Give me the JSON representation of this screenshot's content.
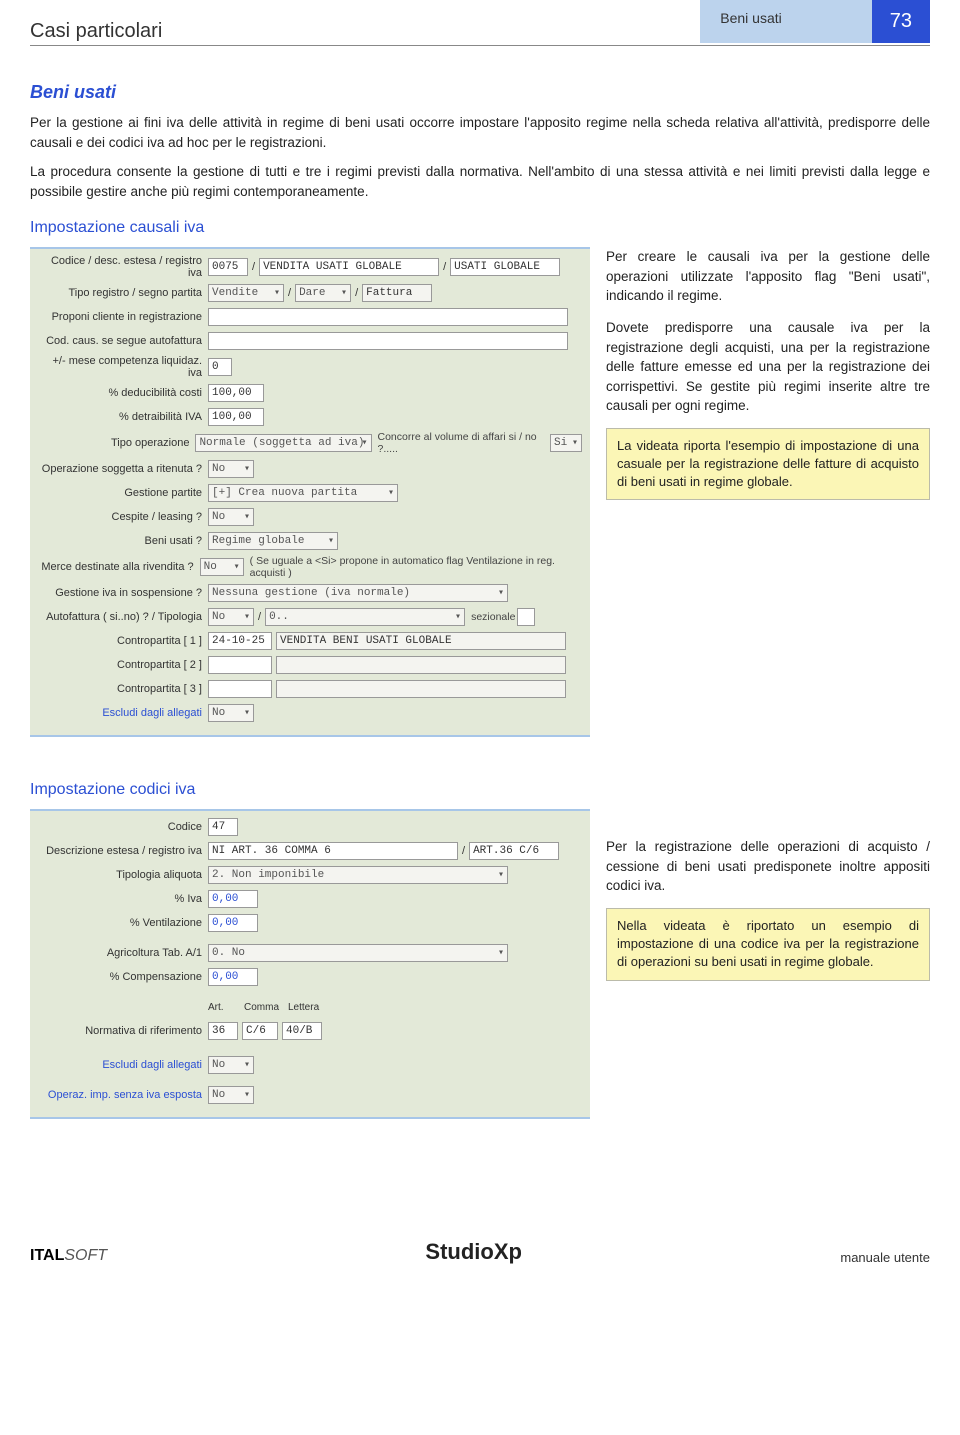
{
  "header": {
    "title": "Casi particolari",
    "tab": "Beni usati",
    "page": "73"
  },
  "section1": {
    "title": "Beni usati",
    "p1": "Per la gestione ai fini iva delle attività in regime di beni usati occorre impostare l'apposito regime nella scheda relativa all'attività, predisporre delle causali e dei codici iva ad hoc per le registrazioni.",
    "p2": "La procedura consente la gestione di tutti e tre i regimi previsti dalla normativa. Nell'ambito di una stessa attività e nei limiti previsti dalla legge e possibile gestire anche più regimi contemporaneamente."
  },
  "section2": {
    "title": "Impostazione causali iva",
    "right_p1": "Per creare le causali iva per la gestione delle operazioni utilizzate l'apposito flag \"Beni usati\", indicando il regime.",
    "right_p2": "Dovete predisporre una causale iva per la registrazione degli acquisti, una per la registrazione delle fatture emesse ed una per la registrazione dei corrispettivi. Se gestite più regimi inserite altre tre causali per ogni regime.",
    "note": "La videata riporta l'esempio di impostazione di una casuale per la registrazione delle fatture di acquisto di beni usati in regime globale."
  },
  "form1": {
    "r1_label": "Codice / desc. estesa / registro iva",
    "r1_code": "0075",
    "r1_desc": "VENDITA USATI GLOBALE",
    "r1_reg": "USATI GLOBALE",
    "r2_label": "Tipo registro / segno partita",
    "r2_tipo": "Vendite",
    "r2_segno": "Dare",
    "r2_fatt": "Fattura",
    "r3_label": "Proponi cliente in registrazione",
    "r4_label": "Cod. caus. se segue autofattura",
    "r5_label": "+/- mese competenza liquidaz. iva",
    "r5_val": "0",
    "r6_label": "% deducibilità costi",
    "r6_val": "100,00",
    "r7_label": "% detraibilità IVA",
    "r7_val": "100,00",
    "r8_label": "Tipo operazione",
    "r8_val": "Normale (soggetta ad iva)",
    "r8_side": "Concorre al volume di affari si / no ?.....",
    "r8_side_val": "Si",
    "r9_label": "Operazione soggetta a ritenuta ?",
    "r9_val": "No",
    "r10_label": "Gestione partite",
    "r10_val": "[+] Crea nuova partita",
    "r11_label": "Cespite / leasing ?",
    "r11_val": "No",
    "r12_label": "Beni usati ?",
    "r12_val": "Regime globale",
    "r13_label": "Merce destinate alla rivendita ?",
    "r13_val": "No",
    "r13_note": "( Se uguale a <Si> propone in automatico flag Ventilazione in reg. acquisti )",
    "r14_label": "Gestione iva in sospensione ?",
    "r14_val": "Nessuna gestione (iva normale)",
    "r15_label": "Autofattura ( si..no) ? / Tipologia",
    "r15_v1": "No",
    "r15_v2": "0..",
    "r15_sez": "sezionale",
    "r16_label": "Contropartita [ 1 ]",
    "r16_code": "24-10-25",
    "r16_desc": "VENDITA BENI USATI GLOBALE",
    "r17_label": "Contropartita [ 2 ]",
    "r18_label": "Contropartita [ 3 ]",
    "r19_label": "Escludi dagli allegati",
    "r19_val": "No"
  },
  "section3": {
    "title": "Impostazione codici iva",
    "right_p1": "Per la registrazione delle operazioni di acquisto / cessione di beni usati predisponete inoltre appositi codici iva.",
    "note": "Nella videata è riportato un esempio di impostazione di una codice iva per la registrazione di operazioni su beni usati in regime globale."
  },
  "form2": {
    "r1_label": "Codice",
    "r1_val": "47",
    "r2_label": "Descrizione estesa / registro iva",
    "r2_desc": "NI ART. 36 COMMA 6",
    "r2_reg": "ART.36 C/6",
    "r3_label": "Tipologia aliquota",
    "r3_val": "2. Non imponibile",
    "r4_label": "% Iva",
    "r4_val": "0,00",
    "r5_label": "% Ventilazione",
    "r5_val": "0,00",
    "r6_label": "Agricoltura Tab. A/1",
    "r6_val": "0. No",
    "r7_label": "% Compensazione",
    "r7_val": "0,00",
    "r8_head_art": "Art.",
    "r8_head_comma": "Comma",
    "r8_head_lett": "Lettera",
    "r8_label": "Normativa di riferimento",
    "r8_art": "36",
    "r8_comma": "C/6",
    "r8_lett": "40/B",
    "r9_label": "Escludi dagli allegati",
    "r9_val": "No",
    "r10_label": "Operaz. imp. senza iva esposta",
    "r10_val": "No"
  },
  "footer": {
    "left_b": "ITAL",
    "left_i": "SOFT",
    "center": "StudioXp",
    "right": "manuale utente"
  }
}
